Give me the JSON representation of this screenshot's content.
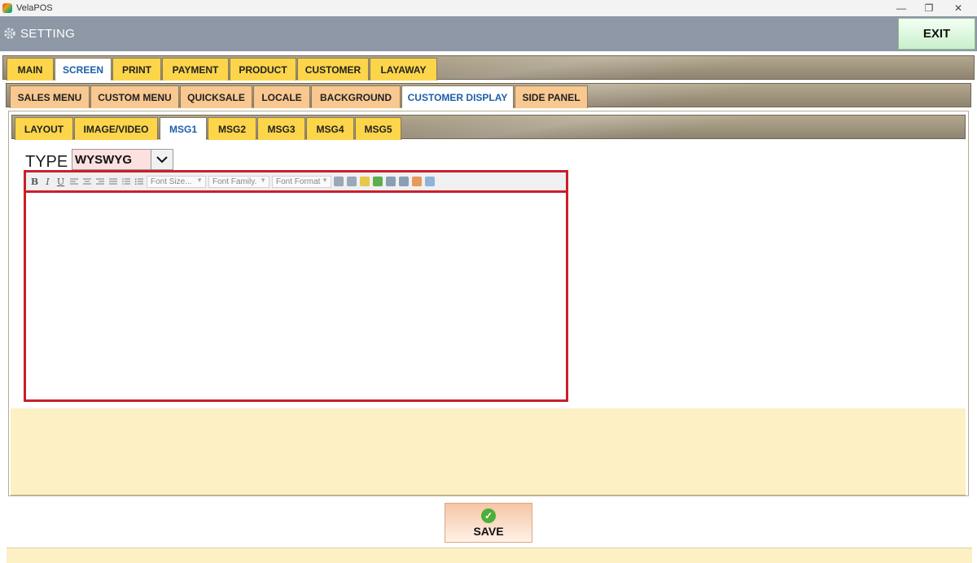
{
  "window": {
    "title": "VelaPOS",
    "minimize": "—",
    "restore": "❐",
    "close": "✕"
  },
  "header": {
    "title": "SETTING",
    "exit_label": "EXIT"
  },
  "main_tabs": [
    {
      "label": "MAIN"
    },
    {
      "label": "SCREEN"
    },
    {
      "label": "PRINT"
    },
    {
      "label": "PAYMENT"
    },
    {
      "label": "PRODUCT"
    },
    {
      "label": "CUSTOMER"
    },
    {
      "label": "LAYAWAY"
    }
  ],
  "main_tabs_active": "SCREEN",
  "sub_tabs": [
    {
      "label": "SALES MENU"
    },
    {
      "label": "CUSTOM MENU"
    },
    {
      "label": "QUICKSALE"
    },
    {
      "label": "LOCALE"
    },
    {
      "label": "BACKGROUND"
    },
    {
      "label": "CUSTOMER DISPLAY"
    },
    {
      "label": "SIDE PANEL"
    }
  ],
  "sub_tabs_active": "CUSTOMER DISPLAY",
  "msg_tabs": [
    {
      "label": "LAYOUT"
    },
    {
      "label": "IMAGE/VIDEO"
    },
    {
      "label": "MSG1"
    },
    {
      "label": "MSG2"
    },
    {
      "label": "MSG3"
    },
    {
      "label": "MSG4"
    },
    {
      "label": "MSG5"
    }
  ],
  "msg_tabs_active": "MSG1",
  "type_field": {
    "label": "TYPE",
    "value": "WYSWYG"
  },
  "editor": {
    "toolbar": {
      "bold": "B",
      "italic": "I",
      "underline": "U",
      "font_size": "Font Size...",
      "font_family": "Font Family.",
      "font_format": "Font Format"
    }
  },
  "save": {
    "label": "SAVE"
  },
  "colors": {
    "accent_red": "#c8202a",
    "tab_yellow": "#fcd54a",
    "tab_peach": "#f8c890",
    "header_gray": "#8e97a6"
  }
}
